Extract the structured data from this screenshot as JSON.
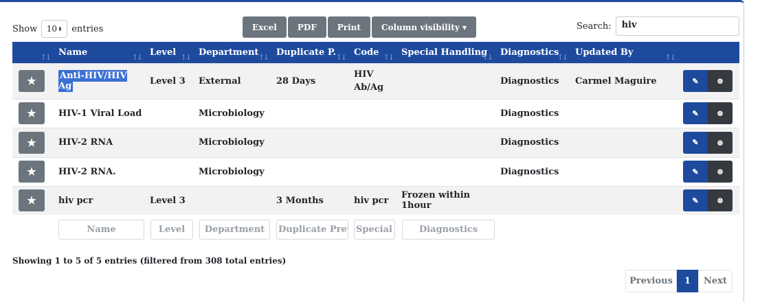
{
  "length_menu": {
    "prefix": "Show",
    "value": "10",
    "suffix": "entries"
  },
  "buttons": {
    "excel": "Excel",
    "pdf": "PDF",
    "print": "Print",
    "colvis": "Column visibility ▾"
  },
  "search": {
    "label": "Search:",
    "value": "hiv"
  },
  "columns": [
    "Name",
    "Level",
    "Department",
    "Duplicate P.",
    "Code",
    "Special Handling",
    "Diagnostics",
    "Updated By"
  ],
  "rows": [
    {
      "name": "Anti-HIV/HIV Ag",
      "level": "Level 3",
      "department": "External",
      "duplicate": "28 Days",
      "code": "HIV Ab/Ag",
      "special": "",
      "diagnostics": "Diagnostics",
      "updated_by": "Carmel Maguire"
    },
    {
      "name": "HIV-1 Viral Load",
      "level": "",
      "department": "Microbiology",
      "duplicate": "",
      "code": "",
      "special": "",
      "diagnostics": "Diagnostics",
      "updated_by": ""
    },
    {
      "name": "HIV-2 RNA",
      "level": "",
      "department": "Microbiology",
      "duplicate": "",
      "code": "",
      "special": "",
      "diagnostics": "Diagnostics",
      "updated_by": ""
    },
    {
      "name": "HIV-2 RNA.",
      "level": "",
      "department": "Microbiology",
      "duplicate": "",
      "code": "",
      "special": "",
      "diagnostics": "Diagnostics",
      "updated_by": ""
    },
    {
      "name": "hiv pcr",
      "level": "Level 3",
      "department": "",
      "duplicate": "3 Months",
      "code": "hiv pcr",
      "special": "Frozen within 1hour",
      "diagnostics": "",
      "updated_by": ""
    }
  ],
  "filters": {
    "name": "Name",
    "level": "Level",
    "department": "Department",
    "duplicate": "Duplicate Prevent",
    "special": "Special Ha",
    "diagnostics": "Diagnostics"
  },
  "info": "Showing 1 to 5 of 5 entries (filtered from 308 total entries)",
  "pagination": {
    "previous": "Previous",
    "page": "1",
    "next": "Next"
  },
  "icons": {
    "star": "star-icon",
    "edit": "edit-icon",
    "delete": "close-circle-icon"
  },
  "colors": {
    "primary": "#1e4a9e",
    "secondary": "#6c757d",
    "dark": "#343a40"
  }
}
